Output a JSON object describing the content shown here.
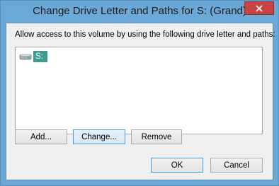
{
  "window": {
    "title": "Change Drive Letter and Paths for S: (Grand)"
  },
  "dialog": {
    "description": "Allow access to this volume by using the following drive letter and paths:",
    "list_items": [
      {
        "label": "S:",
        "icon": "drive-icon",
        "selected": true
      }
    ],
    "buttons": {
      "add": "Add...",
      "change": "Change...",
      "remove": "Remove",
      "ok": "OK",
      "cancel": "Cancel"
    }
  },
  "colors": {
    "title_bar": "#6aa8d8",
    "close_button": "#c74343",
    "selection": "#3b9c8f",
    "dialog_bg": "#f0f0f0"
  }
}
